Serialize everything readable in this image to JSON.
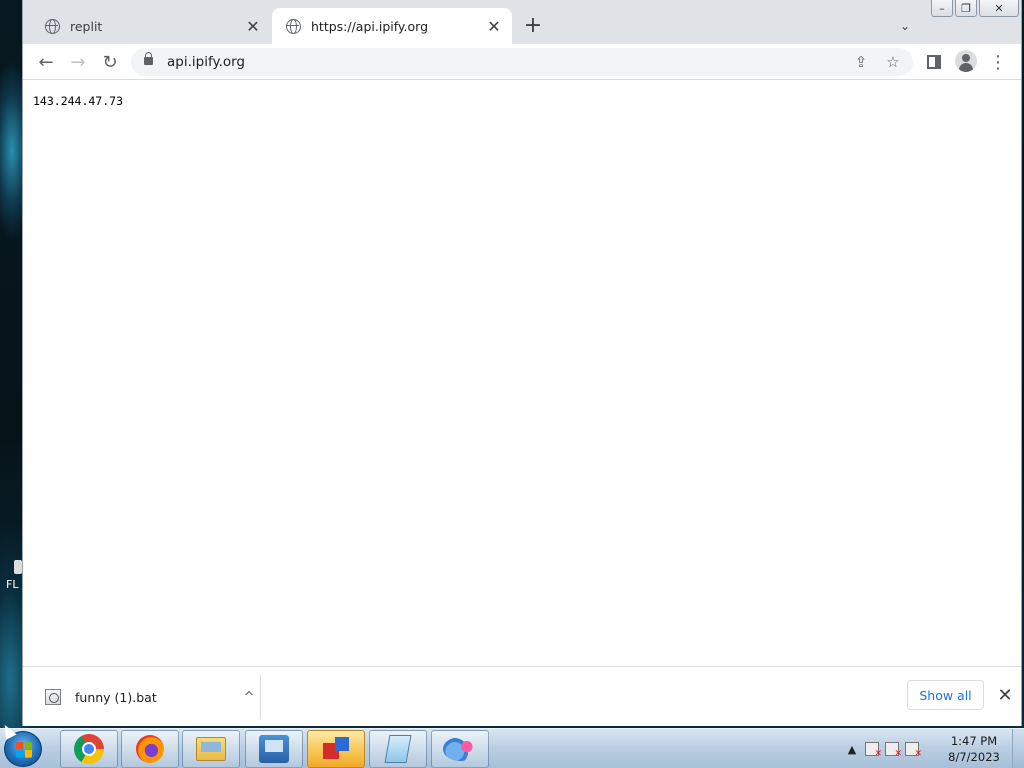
{
  "browser": {
    "tabs": [
      {
        "title": "replit",
        "active": false
      },
      {
        "title": "https://api.ipify.org",
        "active": true
      }
    ],
    "new_tab_glyph": "+",
    "tab_search_glyph": "⌄",
    "close_glyph": "✕",
    "toolbar": {
      "back_glyph": "←",
      "forward_glyph": "→",
      "reload_glyph": "↻",
      "url": "api.ipify.org",
      "share_glyph": "⇪",
      "star_glyph": "☆",
      "menu_glyph": "⋮"
    },
    "window_controls": {
      "minimize": "–",
      "restore": "❐",
      "close": "✕"
    }
  },
  "page": {
    "ip_address": "143.244.47.73"
  },
  "download_shelf": {
    "file_name": "funny (1).bat",
    "chevron_glyph": "^",
    "show_all_label": "Show all",
    "close_glyph": "✕"
  },
  "desktop": {
    "icon_label": "FL"
  },
  "taskbar": {
    "apps": [
      {
        "name": "chrome-icon",
        "active": false
      },
      {
        "name": "firefox-icon",
        "active": false
      },
      {
        "name": "file-explorer-icon",
        "active": false
      },
      {
        "name": "control-panel-icon",
        "active": false
      },
      {
        "name": "app-box-icon",
        "active": true
      },
      {
        "name": "notepad-icon",
        "active": false
      },
      {
        "name": "paint-icon",
        "active": false
      }
    ],
    "tray_arrow_glyph": "▲",
    "clock_time": "1:47 PM",
    "clock_date": "8/7/2023"
  },
  "colors": {
    "accent_blue": "#1a73e8",
    "tabstrip_bg": "#dfe3e8",
    "taskbar_active": "#f7c54e"
  }
}
